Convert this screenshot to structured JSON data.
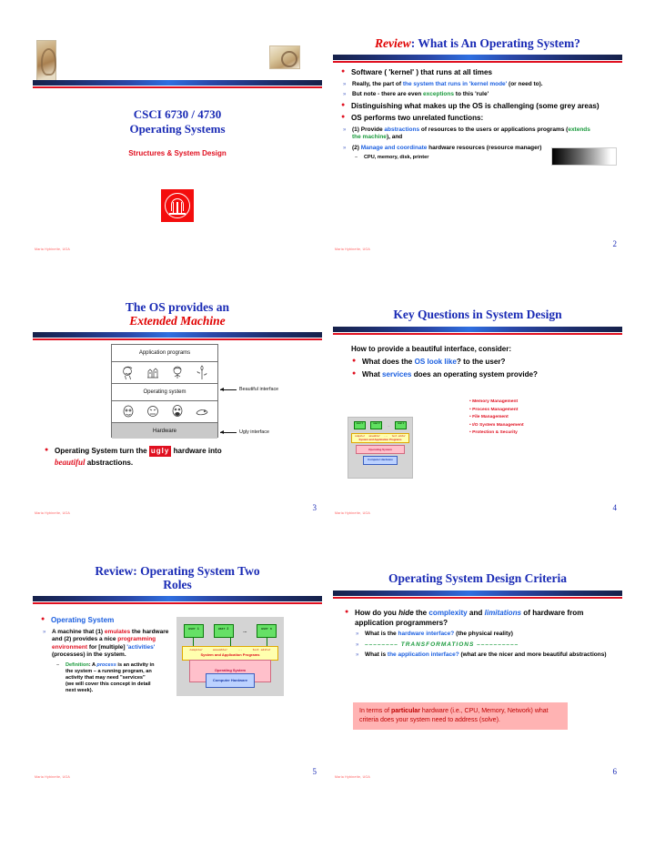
{
  "document": {
    "footer_credit": "Maria Hybinette, UGA",
    "accent_blue": "#1a2bb5",
    "accent_red": "#e01020",
    "link_blue": "#1b5fe0",
    "highlight_green": "#1a9a3c"
  },
  "slides": [
    {
      "number": "",
      "title_line1": "CSCI 6730 /  4730",
      "title_line2": "Operating Systems",
      "subtitle": "Structures & System Design",
      "logo_name": "uga-arch-logo",
      "footer": "Maria Hybinette, UGA"
    },
    {
      "number": "2",
      "title_prefix": "Review",
      "title_rest": ": What is An Operating System?",
      "footer": "Maria Hybinette, UGA",
      "bullets": [
        {
          "level": 1,
          "parts": [
            {
              "t": "Software ( 'kernel' ) that runs at all times",
              "c": "black"
            }
          ]
        },
        {
          "level": 2,
          "parts": [
            {
              "t": "Really, the part of ",
              "c": "black"
            },
            {
              "t": "the system that runs in  'kernel mode'",
              "c": "blue"
            },
            {
              "t": "  (or need to).",
              "c": "black"
            }
          ]
        },
        {
          "level": 2,
          "parts": [
            {
              "t": "But note - there are even ",
              "c": "black"
            },
            {
              "t": "exceptions",
              "c": "green"
            },
            {
              "t": " to this  'rule'",
              "c": "black"
            }
          ]
        },
        {
          "level": 1,
          "parts": [
            {
              "t": "Distinguishing what makes up the OS is challenging (some grey areas)",
              "c": "black"
            }
          ]
        },
        {
          "level": 1,
          "parts": [
            {
              "t": "OS performs two unrelated functions:",
              "c": "black"
            }
          ]
        },
        {
          "level": 2,
          "parts": [
            {
              "t": "(1) Provide ",
              "c": "black"
            },
            {
              "t": "abstractions",
              "c": "blue"
            },
            {
              "t": " of resources to the users or applications programs (",
              "c": "black"
            },
            {
              "t": "extends the machine",
              "c": "green"
            },
            {
              "t": "), and",
              "c": "black"
            }
          ]
        },
        {
          "level": 2,
          "parts": [
            {
              "t": "(2) ",
              "c": "black"
            },
            {
              "t": "Manage and coordinate",
              "c": "blue"
            },
            {
              "t": " hardware resources (resource manager)",
              "c": "black"
            }
          ]
        },
        {
          "level": 3,
          "parts": [
            {
              "t": "CPU, memory, disk, printer",
              "c": "black"
            }
          ]
        }
      ],
      "gradient_box_name": "grey-area-gradient"
    },
    {
      "number": "3",
      "title_line1": "The OS provides an",
      "title_line2": "Extended Machine",
      "footer": "Maria Hybinette, UGA",
      "diagram": {
        "layers": [
          "Application programs",
          "Operating system",
          "Hardware"
        ],
        "annotations": [
          "Beautiful interface",
          "Ugly interface"
        ]
      },
      "bottom_text": {
        "lead": "Operating System turn the ",
        "ugly": "ugly",
        "mid": " hardware into ",
        "beautiful": "beautiful",
        "tail": " abstractions."
      }
    },
    {
      "number": "4",
      "title": "Key Questions in System Design",
      "footer": "Maria Hybinette, UGA",
      "intro": "How to provide a beautiful interface, consider:",
      "bullets": [
        {
          "parts": [
            {
              "t": "What does the ",
              "c": "black"
            },
            {
              "t": "OS look like",
              "c": "blue"
            },
            {
              "t": "? to the user?",
              "c": "black"
            }
          ]
        },
        {
          "parts": [
            {
              "t": "What ",
              "c": "black"
            },
            {
              "t": "services",
              "c": "blue"
            },
            {
              "t": " does an operating system provide?",
              "c": "black"
            }
          ]
        }
      ],
      "services": [
        "Memory Management",
        "Process Management",
        "File Management",
        "I/O System Management",
        "Protection & Security"
      ],
      "diagram": {
        "users": [
          "user 1",
          "user 2",
          "user n"
        ],
        "dots": "...",
        "tools": [
          "compiler",
          "assembler",
          "...",
          "text editor"
        ],
        "programs_label": "System and Application Programs",
        "os_label": "Operating System",
        "hardware_label": "Computer Hardware"
      }
    },
    {
      "number": "5",
      "title_line1": "Review: Operating System Two",
      "title_line2": "Roles",
      "footer": "Maria Hybinette, UGA",
      "heading": "Operating System",
      "body_parts": [
        {
          "t": "A  machine that (1) ",
          "c": "black"
        },
        {
          "t": "emulates",
          "c": "red"
        },
        {
          "t": " the hardware and (2) provides a nice ",
          "c": "black"
        },
        {
          "t": "programming environment",
          "c": "red"
        },
        {
          "t": " for [multiple] ",
          "c": "black"
        },
        {
          "t": "'activities'",
          "c": "blue"
        },
        {
          "t": " (processes)  in the system.",
          "c": "black"
        }
      ],
      "definition_parts": [
        {
          "t": "Definition",
          "c": "green"
        },
        {
          "t": ": A ",
          "c": "black"
        },
        {
          "t": "process",
          "c": "blue"
        },
        {
          "t": " is an activity in the system – a running program, an activity that may need \"services\"  (we will cover this concept in detail next week).",
          "c": "black"
        }
      ],
      "diagram": {
        "users": [
          "user 1",
          "user 2",
          "user n"
        ],
        "dots": "...",
        "tools": [
          "compiler",
          "assembler",
          "...",
          "text editor"
        ],
        "programs_label": "System and Application Programs",
        "os_label": "Operating System",
        "hardware_label": "Computer Hardware"
      }
    },
    {
      "number": "6",
      "title": "Operating System Design Criteria",
      "footer": "Maria Hybinette, UGA",
      "bullets": [
        {
          "level": 1,
          "parts": [
            {
              "t": "How do you ",
              "c": "black"
            },
            {
              "t": "hide",
              "c": "black-italic"
            },
            {
              "t": " the ",
              "c": "black"
            },
            {
              "t": "complexity",
              "c": "blue"
            },
            {
              "t": " and ",
              "c": "black"
            },
            {
              "t": "limitations",
              "c": "blue-italic"
            },
            {
              "t": " of hardware from application programmers?",
              "c": "black"
            }
          ]
        },
        {
          "level": 2,
          "parts": [
            {
              "t": "What is the ",
              "c": "black"
            },
            {
              "t": "hardware interface?",
              "c": "blue"
            },
            {
              "t": "  (the physical reality)",
              "c": "black"
            }
          ]
        },
        {
          "level": 2,
          "transformations": "––––––––  TRANSFORMATIONS  ––––––––––"
        },
        {
          "level": 2,
          "parts": [
            {
              "t": "What is ",
              "c": "black"
            },
            {
              "t": "the application interface?",
              "c": "blue"
            },
            {
              "t": "  (what are the nicer and more beautiful abstractions)",
              "c": "black"
            }
          ]
        }
      ],
      "callout": {
        "pre": "In terms of ",
        "bold": "particular",
        "post": " hardware (i.e., CPU, Memory, Network) what criteria does your system need to address (solve)."
      }
    }
  ]
}
